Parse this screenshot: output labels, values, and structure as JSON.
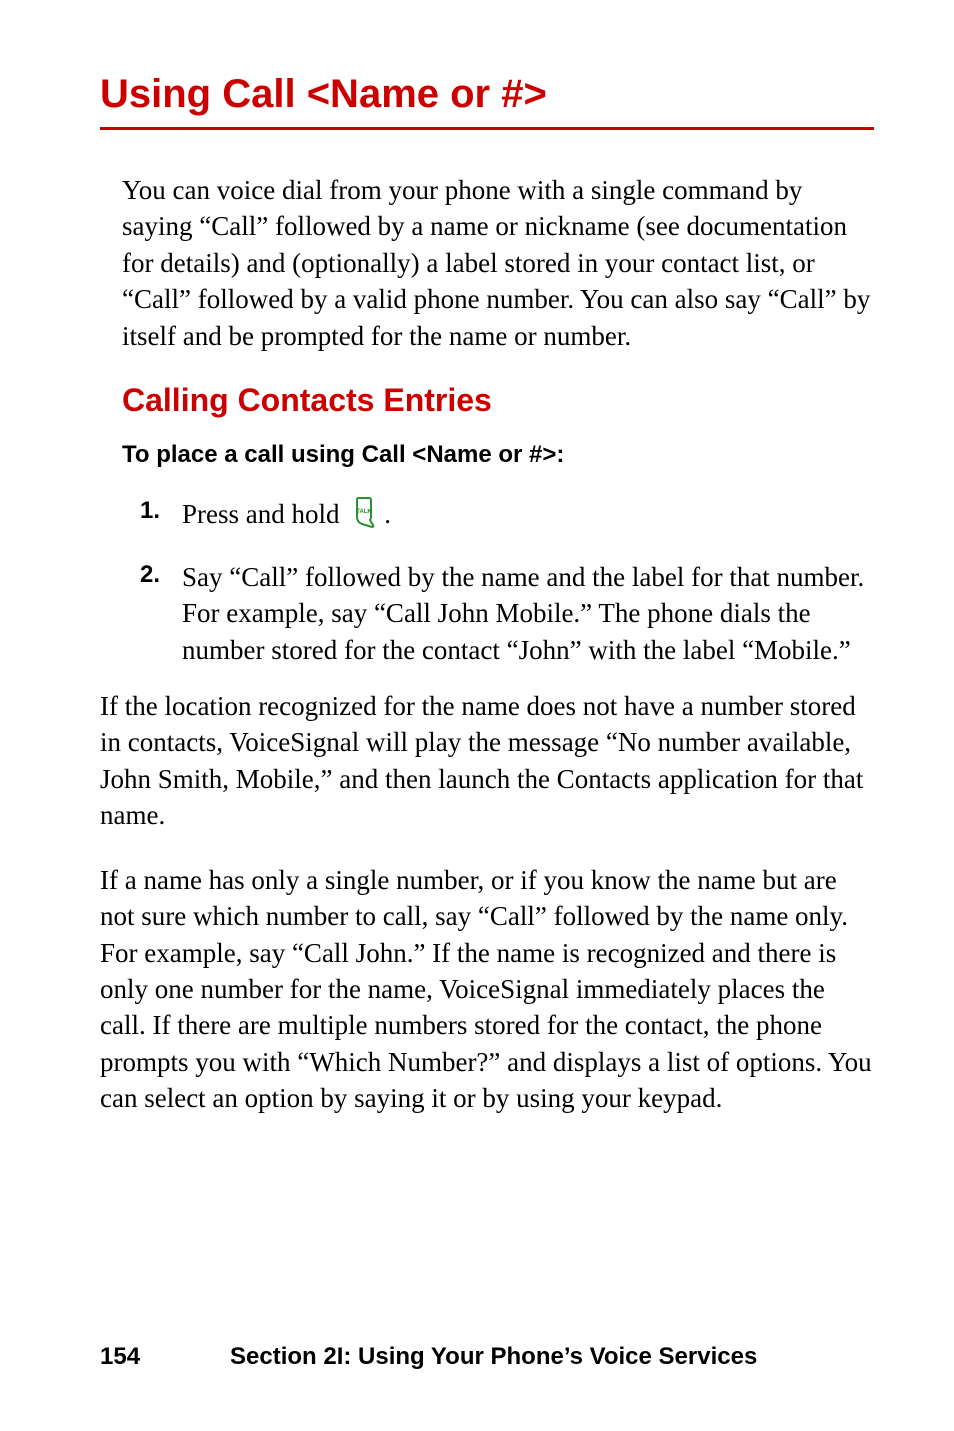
{
  "title": "Using Call <Name or #>",
  "intro": "You can voice dial from your phone with a single command by saying “Call” followed by a name or nickname (see documentation for details) and (optionally) a label stored in your contact list, or “Call” followed by a valid phone number. You can also say “Call” by itself and be prompted for the name or number.",
  "subheading": "Calling Contacts Entries",
  "instruction": "To place a call using Call <Name or #>:",
  "steps": [
    {
      "num": "1.",
      "text_before": "Press and hold ",
      "text_after": "."
    },
    {
      "num": "2.",
      "text": "Say “Call” followed by the name and the label for that number. For example, say “Call John Mobile.” The phone dials the number stored for the contact “John” with the label “Mobile.”"
    }
  ],
  "para2": "If the location recognized for the name does not have a number stored in contacts, VoiceSignal will play the message “No number available, John Smith, Mobile,” and then launch the Contacts application for that name.",
  "para3": "If a name has only a single number, or if you know the name but are not sure which number to call, say “Call” followed by the name only. For example, say “Call John.” If the name is recognized and there is only one number for the name, VoiceSignal immediately places the call. If there are multiple numbers stored for the contact, the phone prompts you with “Which Number?” and displays a list of options. You can select an option by saying it or by using your keypad.",
  "footer": {
    "page": "154",
    "section": "Section 2I: Using Your Phone’s Voice Services"
  }
}
